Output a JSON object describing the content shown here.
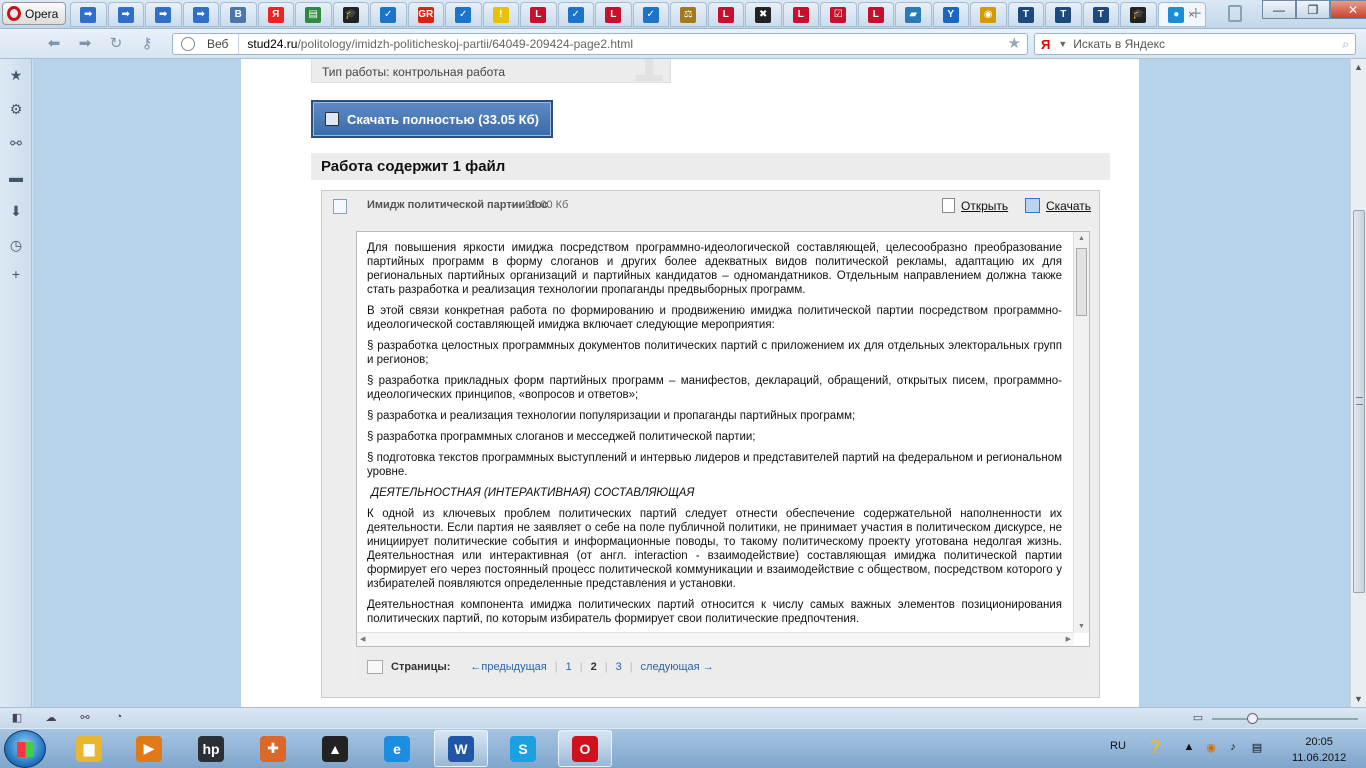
{
  "browser": {
    "menu_label": "Opera",
    "tabs": [
      {
        "icon": "arrow-icon",
        "color": "#2f6fc9",
        "glyph": "➡"
      },
      {
        "icon": "arrow-icon",
        "color": "#2f6fc9",
        "glyph": "➡"
      },
      {
        "icon": "arrow-icon",
        "color": "#2f6fc9",
        "glyph": "➡"
      },
      {
        "icon": "arrow-icon",
        "color": "#2f6fc9",
        "glyph": "➡"
      },
      {
        "icon": "vk-icon",
        "color": "#4a76a8",
        "glyph": "В"
      },
      {
        "icon": "yandex-icon",
        "color": "#e22",
        "glyph": "Я"
      },
      {
        "icon": "doc-icon",
        "color": "#2d8a3e",
        "glyph": "▤"
      },
      {
        "icon": "graduation-cap-icon",
        "color": "#222",
        "glyph": "🎓"
      },
      {
        "icon": "checkbox-icon",
        "color": "#1b74c9",
        "glyph": "✓"
      },
      {
        "icon": "gr-icon",
        "color": "#d21",
        "glyph": "GR"
      },
      {
        "icon": "checkbox-icon",
        "color": "#1b74c9",
        "glyph": "✓"
      },
      {
        "icon": "exclamation-icon",
        "color": "#e6c200",
        "glyph": "!"
      },
      {
        "icon": "l-icon",
        "color": "#c8102e",
        "glyph": "L"
      },
      {
        "icon": "checkbox-icon",
        "color": "#1b74c9",
        "glyph": "✓"
      },
      {
        "icon": "l-icon",
        "color": "#c8102e",
        "glyph": "L"
      },
      {
        "icon": "checkbox-icon",
        "color": "#1b74c9",
        "glyph": "✓"
      },
      {
        "icon": "scales-icon",
        "color": "#a27a1c",
        "glyph": "⚖"
      },
      {
        "icon": "l-icon",
        "color": "#c8102e",
        "glyph": "L"
      },
      {
        "icon": "x-icon",
        "color": "#222",
        "glyph": "✖"
      },
      {
        "icon": "l-icon",
        "color": "#c8102e",
        "glyph": "L"
      },
      {
        "icon": "check-list-icon",
        "color": "#c8102e",
        "glyph": "☑"
      },
      {
        "icon": "l-icon",
        "color": "#c8102e",
        "glyph": "L"
      },
      {
        "icon": "book-icon",
        "color": "#2a7bb3",
        "glyph": "▰"
      },
      {
        "icon": "y-icon",
        "color": "#1a66c2",
        "glyph": "Y"
      },
      {
        "icon": "circle-icon",
        "color": "#d49b00",
        "glyph": "◉"
      },
      {
        "icon": "t-icon",
        "color": "#1c4a7a",
        "glyph": "T"
      },
      {
        "icon": "t-icon",
        "color": "#1c4a7a",
        "glyph": "T"
      },
      {
        "icon": "t-icon",
        "color": "#1c4a7a",
        "glyph": "T"
      },
      {
        "icon": "graduation-cap-icon",
        "color": "#222",
        "glyph": "🎓"
      }
    ],
    "active_tab": {
      "icon": "site-icon",
      "color": "#1a8fd6",
      "glyph": "●",
      "close": "×"
    },
    "window_controls": {
      "minimize": "—",
      "maximize": "❐",
      "close": "✕"
    },
    "address": {
      "mode_label": "Веб",
      "host": "stud24.ru",
      "path": "/politology/imidzh-politicheskoj-partii/64049-209424-page2.html"
    },
    "search": {
      "engine": "Я",
      "placeholder": "Искать в Яндекс"
    }
  },
  "page": {
    "top_fragment": "Тип работы: контрольная работа",
    "top_fragment_digit": "1",
    "download_button": "Скачать полностью (33.05 Кб)",
    "files_heading": "Работа содержит 1 файл",
    "file": {
      "name": "Имидж политической партии.doc",
      "size": "— 99.00 Кб",
      "open_label": "Открыть",
      "download_label": "Скачать"
    },
    "preview": {
      "paragraphs": [
        "Для повышения яркости имиджа посредством программно-идеологической составляющей, целесообразно преобразование партийных программ в форму слоганов и других более адекватных видов политической рекламы, адаптацию их для региональных партийных организаций и партийных кандидатов – одномандатников. Отдельным направлением должна также стать разработка и реализация технологии пропаганды предвыборных программ.",
        "В этой связи конкретная работа по формированию и продвижению имиджа политической партии посредством программно-идеологической составляющей имиджа включает следующие мероприятия:",
        "§ разработка целостных программных документов политических партий с приложением их для отдельных электоральных групп и регионов;",
        "§ разработка прикладных форм партийных программ – манифестов, деклараций, обращений, открытых писем, программно-идеологических принципов, «вопросов и ответов»;",
        "§ разработка и реализация технологии популяризации и пропаганды партийных программ;",
        "§ разработка программных слоганов и месседжей политической партии;",
        "§ подготовка текстов программных выступлений и интервью лидеров и представителей партий на федеральном и региональном уровне."
      ],
      "heading": "ДЕЯТЕЛЬНОСТНАЯ (ИНТЕРАКТИВНАЯ) СОСТАВЛЯЮЩАЯ",
      "paragraphs2": [
        "К одной из ключевых проблем политических партий следует отнести обеспечение содержательной наполненности их деятельности. Если партия не заявляет о себе на поле публичной политики, не принимает участия в политическом дискурсе, не инициирует политические события и информационные поводы, то такому политическому проекту уготована недолгая жизнь. Деятельностная или интерактивная (от англ. interaction - взаимодействие) составляющая имиджа политической партии формирует его через постоянный процесс политической коммуникации и взаимодействие с обществом, посредством которого у избирателей появляются определенные представления и установки.",
        "Деятельностная компонента имиджа политических партий относится к числу самых важных элементов позиционирования политических партий, по которым избиратель формирует свои политические предпочтения."
      ]
    },
    "pager": {
      "label": "Страницы:",
      "prev": "←предыдущая",
      "p1": "1",
      "p2": "2",
      "p3": "3",
      "next": "следующая →"
    }
  },
  "taskbar": {
    "apps": [
      {
        "name": "explorer",
        "icon": "folder-icon",
        "color": "#e8b72f",
        "glyph": "▆"
      },
      {
        "name": "media-player",
        "icon": "play-icon",
        "color": "#e07a18",
        "glyph": "▶"
      },
      {
        "name": "hp",
        "icon": "hp-icon",
        "color": "#2b2f36",
        "glyph": "hp"
      },
      {
        "name": "paint",
        "icon": "palette-icon",
        "color": "#d9682a",
        "glyph": "✚"
      },
      {
        "name": "aimp",
        "icon": "triangle-icon",
        "color": "#222",
        "glyph": "▲"
      },
      {
        "name": "ie",
        "icon": "ie-icon",
        "color": "#1b8ee0",
        "glyph": "e"
      },
      {
        "name": "word",
        "icon": "word-icon",
        "color": "#1f56a8",
        "glyph": "W"
      },
      {
        "name": "skype",
        "icon": "skype-icon",
        "color": "#1ba0e0",
        "glyph": "S"
      },
      {
        "name": "opera",
        "icon": "opera-icon",
        "color": "#d0111b",
        "glyph": "O"
      }
    ],
    "lang": "RU",
    "time": "20:05",
    "date": "11.06.2012"
  }
}
